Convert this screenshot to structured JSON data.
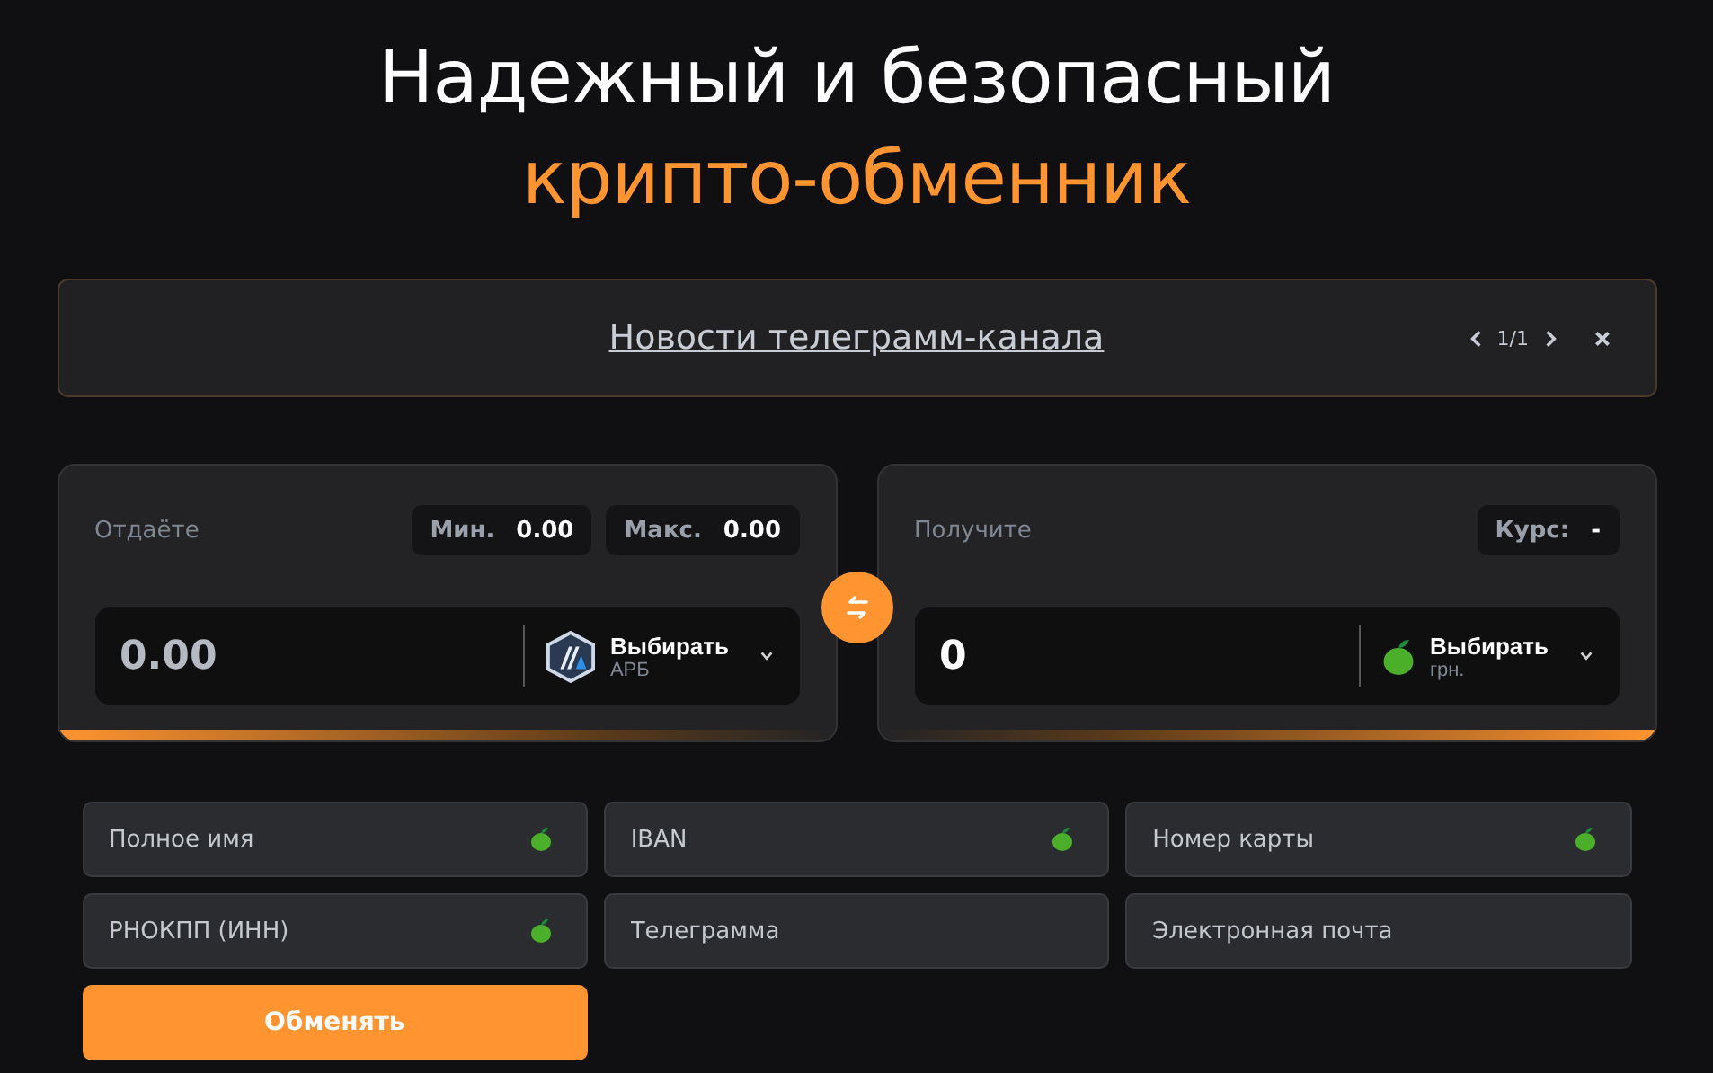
{
  "heading": {
    "line_1": "Надежный и безопасный",
    "line_2": "крипто-обменник"
  },
  "news": {
    "link": "Новости телеграмм-канала",
    "pager": "1/1"
  },
  "give": {
    "label": "Отдаёте",
    "limits": [
      {
        "label": "Мин.",
        "value": "0.00"
      },
      {
        "label": "Макс.",
        "value": "0.00"
      }
    ],
    "amount": "0.00",
    "currency": {
      "kind": "arb",
      "title": "Выбирать",
      "code": "АРБ"
    }
  },
  "get": {
    "label": "Получите",
    "limits": [
      {
        "label": "Курс:",
        "value": "-"
      }
    ],
    "amount": "0",
    "currency": {
      "kind": "apple",
      "title": "Выбирать",
      "code": "грн."
    }
  },
  "fields": [
    {
      "placeholder": "Полное имя",
      "required": true
    },
    {
      "placeholder": "IBAN",
      "required": true
    },
    {
      "placeholder": "Номер карты",
      "required": true
    },
    {
      "placeholder": "РНОКПП (ИНН)",
      "required": true
    },
    {
      "placeholder": "Телеграмма",
      "required": false
    },
    {
      "placeholder": "Электронная почта",
      "required": false
    }
  ],
  "submit": "Обменять"
}
